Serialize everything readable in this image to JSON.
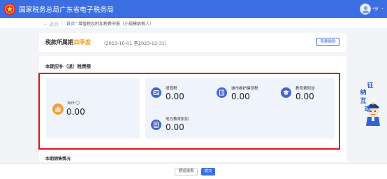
{
  "header": {
    "title": "国家税务总局广东省电子税务局",
    "user_name": "*岁",
    "user_caret": "⌄"
  },
  "breadcrumb": {
    "back": "← 返回",
    "sep": "|",
    "home": "首页",
    "arrow": ">",
    "current": "增值税及附加税费申报（小规模纳税人）"
  },
  "period": {
    "label": "税款所属期",
    "quarter": "四季度",
    "range": "（2023-10-01 至2023-12-31）",
    "button_label": "我要缴款"
  },
  "tax_section": {
    "heading": "本期应补（退）税费额",
    "total": {
      "label": "合计",
      "info": "i",
      "value": "0.00"
    },
    "items": [
      {
        "label": "增值税",
        "value": "0.00",
        "icon": "id-card-icon"
      },
      {
        "label": "城市维护建设税",
        "value": "0.00",
        "icon": "building-icon"
      },
      {
        "label": "教育费附加",
        "value": "0.00",
        "icon": "graduation-cap-icon"
      },
      {
        "label": "地方教育附加",
        "value": "0.00",
        "icon": "document-list-icon"
      }
    ]
  },
  "sales_section": {
    "heading": "本期销售情况"
  },
  "mascot": {
    "chars": [
      "征",
      "纳",
      "互",
      "动"
    ]
  },
  "footer": {
    "preview_label": "预览报表",
    "submit_label": "提交"
  },
  "colors": {
    "brand_blue": "#3b6ee0",
    "highlight_red": "#e0141a",
    "quarter_orange": "#f2a12c",
    "total_icon_orange": "#f0a23a",
    "item_icon_blue": "#4564d2",
    "panel_bg": "#eff3fb"
  }
}
